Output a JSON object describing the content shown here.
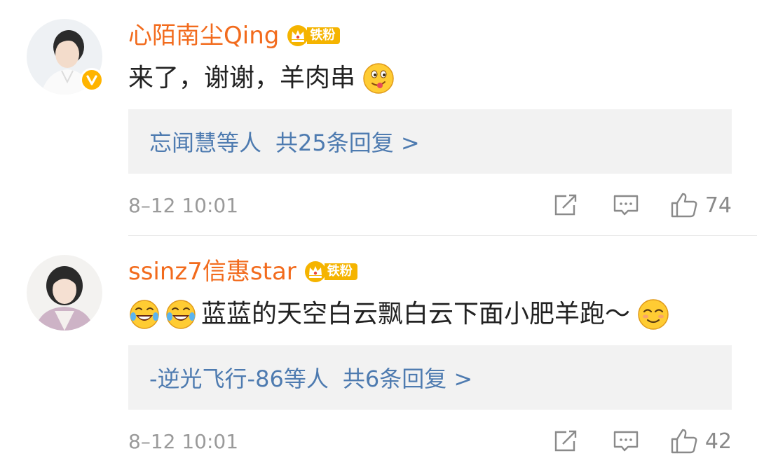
{
  "comments": [
    {
      "username": "心陌南尘Qing",
      "badge_label": "铁粉",
      "text": "来了，谢谢，羊肉串",
      "reply_users": "忘闻慧等人",
      "reply_count": "共25条回复 >",
      "time": "8–12 10:01",
      "likes": "74",
      "verified": true,
      "emoji_after": "yummy-face"
    },
    {
      "username": "ssinz7信惠star",
      "badge_label": "铁粉",
      "text": "蓝蓝的天空白云飘白云下面小肥羊跑～",
      "reply_users": "-逆光飞行-86等人",
      "reply_count": "共6条回复 >",
      "time": "8–12 10:01",
      "likes": "42",
      "verified": false,
      "emoji_before": [
        "laugh-cry-face",
        "laugh-cry-face"
      ],
      "emoji_after": "smirk-face"
    }
  ],
  "colors": {
    "username": "#f26b1d",
    "link": "#4e7bb0",
    "badge": "#f5b400",
    "reply_bg": "#f2f2f2"
  }
}
